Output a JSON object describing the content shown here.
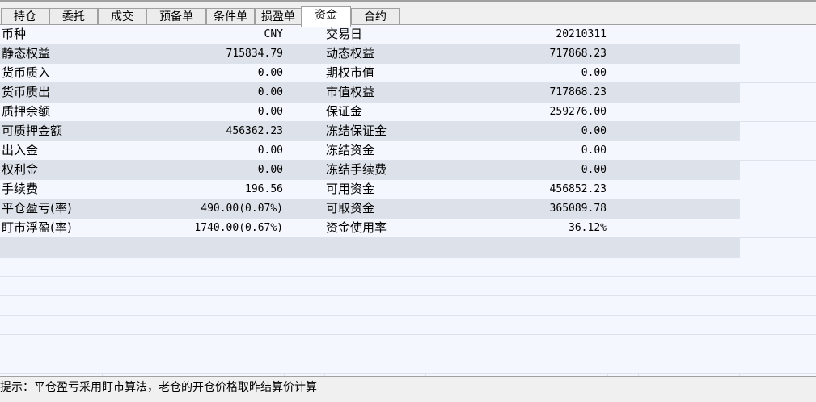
{
  "tabs": [
    {
      "label": "持仓",
      "active": false
    },
    {
      "label": "委托",
      "active": false
    },
    {
      "label": "成交",
      "active": false
    },
    {
      "label": "预备单",
      "active": false
    },
    {
      "label": "条件单",
      "active": false
    },
    {
      "label": "损盈单",
      "active": false
    },
    {
      "label": "资金",
      "active": true
    },
    {
      "label": "合约",
      "active": false
    }
  ],
  "funds": {
    "rows": [
      {
        "label1": "币种",
        "value1": "CNY",
        "label2": "交易日",
        "value2": "20210311"
      },
      {
        "label1": "静态权益",
        "value1": "715834.79",
        "label2": "动态权益",
        "value2": "717868.23"
      },
      {
        "label1": "货币质入",
        "value1": "0.00",
        "label2": "期权市值",
        "value2": "0.00"
      },
      {
        "label1": "货币质出",
        "value1": "0.00",
        "label2": "市值权益",
        "value2": "717868.23"
      },
      {
        "label1": "质押余额",
        "value1": "0.00",
        "label2": "保证金",
        "value2": "259276.00"
      },
      {
        "label1": "可质押金额",
        "value1": "456362.23",
        "label2": "冻结保证金",
        "value2": "0.00"
      },
      {
        "label1": "出入金",
        "value1": "0.00",
        "label2": "冻结资金",
        "value2": "0.00"
      },
      {
        "label1": "权利金",
        "value1": "0.00",
        "label2": "冻结手续费",
        "value2": "0.00"
      },
      {
        "label1": "手续费",
        "value1": "196.56",
        "label2": "可用资金",
        "value2": "456852.23"
      },
      {
        "label1": "平仓盈亏(率)",
        "value1": "490.00(0.07%)",
        "label2": "可取资金",
        "value2": "365089.78"
      },
      {
        "label1": "盯市浮盈(率)",
        "value1": "1740.00(0.67%)",
        "label2": "资金使用率",
        "value2": "36.12%"
      }
    ]
  },
  "status": {
    "hint": "提示：平仓盈亏采用盯市算法，老仓的开仓价格取昨结算价计算"
  },
  "colors": {
    "row_shade": "#dde2ea",
    "row_plain": "#f4f8fe",
    "grid_line": "#dde3ec",
    "tab_active_bg": "#ffffff",
    "tab_bg": "#ececec"
  }
}
